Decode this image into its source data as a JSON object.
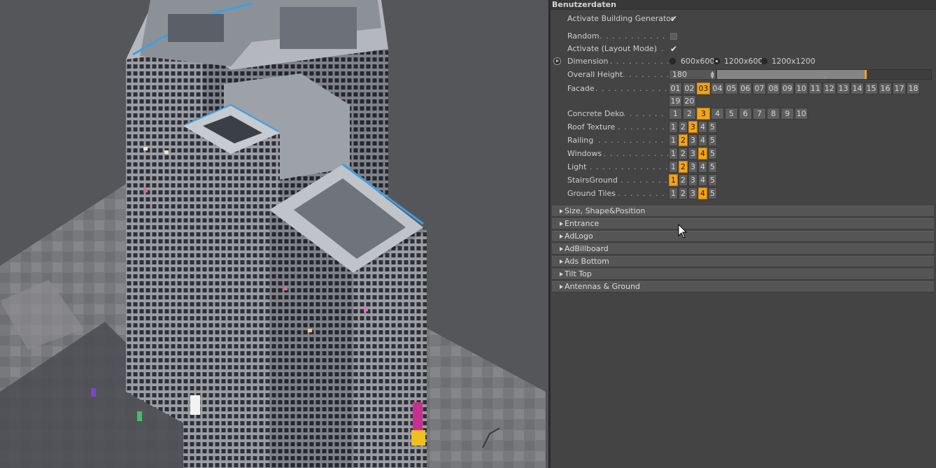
{
  "panel": {
    "title": "Benutzerdaten",
    "activate_generator": {
      "label": "Activate Building Generator",
      "checked": true
    },
    "random": {
      "label": "Random",
      "dots": ". . . . . . . . . . . . . . . . .",
      "checked": false
    },
    "layout_mode": {
      "label": "Activate (Layout Mode)",
      "dots": ". . . . .",
      "checked": true
    },
    "dimension": {
      "label": "Dimension",
      "dots": ". . . . . . . . . . . . . . .",
      "options": [
        "600x600",
        "1200x600",
        "1200x1200"
      ],
      "selected": "1200x600"
    },
    "overall_height": {
      "label": "Overall Height",
      "dots": ". . . . . . . . . . .",
      "value": "180",
      "fraction": 0.69
    },
    "facade": {
      "label": "Facade",
      "dots": ". . . . . . . . . . . . . . . . . . .",
      "options": [
        "01",
        "02",
        "03",
        "04",
        "05",
        "06",
        "07",
        "08",
        "09",
        "10",
        "11",
        "12",
        "13",
        "14",
        "15",
        "16",
        "17",
        "18",
        "19",
        "20"
      ],
      "selected": "03"
    },
    "concrete_deko": {
      "label": "Concrete Deko",
      "dots": ". . . . . . . . . . .",
      "options": [
        "1",
        "2",
        "3",
        "4",
        "5",
        "6",
        "7",
        "8",
        "9",
        "10"
      ],
      "selected": "3"
    },
    "roof_texture": {
      "label": "Roof Texture",
      "dots": ". . . . . . . . . . . .",
      "options": [
        "1",
        "2",
        "3",
        "4",
        "5"
      ],
      "selected": "3"
    },
    "railing": {
      "label": "Railing",
      "dots": ". . . . . . . . . . . . . . . . . .",
      "options": [
        "1",
        "2",
        "3",
        "4",
        "5"
      ],
      "selected": "2"
    },
    "windows": {
      "label": "Windows",
      "dots": ". . . . . . . . . . . . . . . . .",
      "options": [
        "1",
        "2",
        "3",
        "4",
        "5"
      ],
      "selected": "4"
    },
    "light": {
      "label": "Light",
      "dots": ". . . . . . . . . . . . . . . . . . . . .",
      "options": [
        "1",
        "2",
        "3",
        "4",
        "5"
      ],
      "selected": "2"
    },
    "stairs_ground": {
      "label": "StairsGround",
      "dots": ". . . . . . . . . . .",
      "options": [
        "1",
        "2",
        "3",
        "4",
        "5"
      ],
      "selected": "1"
    },
    "ground_tiles": {
      "label": "Ground Tiles",
      "dots": ". . . . . . . . . . . .",
      "options": [
        "1",
        "2",
        "3",
        "4",
        "5"
      ],
      "selected": "4"
    },
    "sections": [
      "Size, Shape&Position",
      "Entrance",
      "AdLogo",
      "AdBillboard",
      "Ads Bottom",
      "Tilt Top",
      "Antennas & Ground"
    ]
  },
  "colors": {
    "accent": "#f4a418",
    "panel_bg": "#444444",
    "viewport_bg": "#555659"
  },
  "icons": {
    "checkmark": "checkmark-icon",
    "animation": "keyframe-icon",
    "expand": "expand-triangle-icon",
    "cursor": "mouse-pointer-icon"
  }
}
